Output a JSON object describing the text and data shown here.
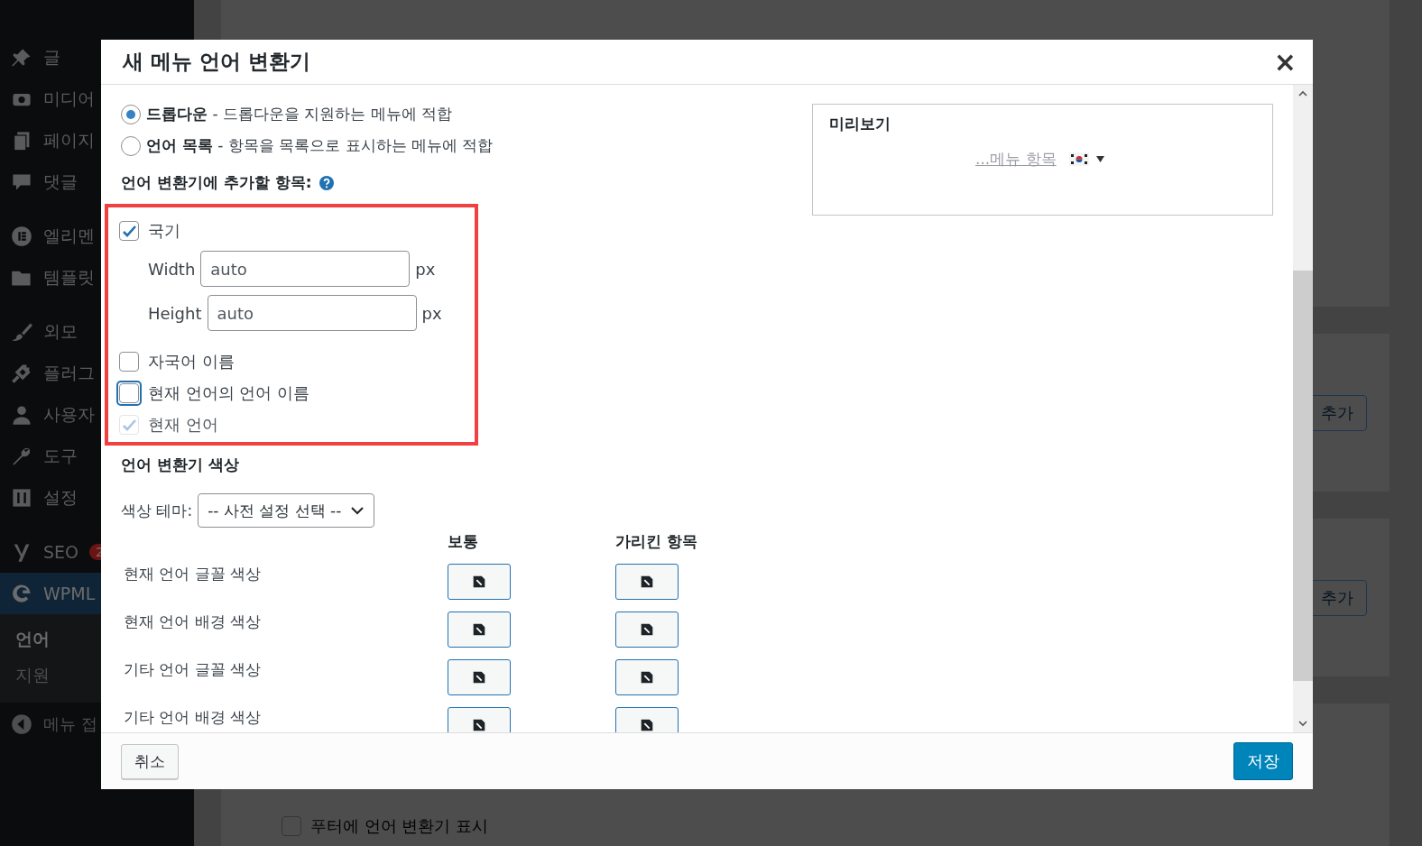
{
  "sidebar": {
    "groups": [
      [
        {
          "label": "글",
          "selected": false
        },
        {
          "label": "미디어",
          "selected": false
        },
        {
          "label": "페이지",
          "selected": false
        },
        {
          "label": "댓글",
          "selected": false
        }
      ],
      [
        {
          "label": "엘리멘",
          "selected": false
        },
        {
          "label": "템플릿",
          "selected": false
        }
      ],
      [
        {
          "label": "외모",
          "selected": false
        },
        {
          "label": "플러그",
          "selected": false
        },
        {
          "label": "사용자",
          "selected": false
        },
        {
          "label": "도구",
          "selected": false
        },
        {
          "label": "설정",
          "selected": false
        }
      ],
      [
        {
          "label": "SEO",
          "badge": "2",
          "selected": false
        },
        {
          "label": "WPML",
          "selected": true
        }
      ]
    ],
    "submenu": [
      {
        "label": "언어",
        "selected": true
      },
      {
        "label": "지원",
        "selected": false
      }
    ],
    "collapse": "메뉴 접"
  },
  "background": {
    "add_buttons": [
      "추가",
      "추가"
    ],
    "footer_checkbox": {
      "label": "푸터에 언어 변환기 표시",
      "checked": false
    }
  },
  "dialog": {
    "title": "새 메뉴 언어 변환기",
    "close": "×",
    "styles": [
      {
        "name": "드롭다운",
        "description": " - 드롭다운을 지원하는 메뉴에 적합",
        "selected": true
      },
      {
        "name": "언어 목록",
        "description": " - 항목을 목록으로 표시하는 메뉴에 적합",
        "selected": false
      }
    ],
    "items_heading": "언어 변환기에 추가할 항목:",
    "options": [
      {
        "kind": "checkbox",
        "label": "국기",
        "checked": true,
        "focused": false,
        "disabled": false
      },
      {
        "kind": "size",
        "label": "Width",
        "value": "auto",
        "unit": "px"
      },
      {
        "kind": "size",
        "label": "Height",
        "value": "auto",
        "unit": "px"
      },
      {
        "kind": "checkbox",
        "label": "자국어 이름",
        "checked": false,
        "focused": false,
        "disabled": false
      },
      {
        "kind": "checkbox",
        "label": "현재 언어의 언어 이름",
        "checked": false,
        "focused": true,
        "disabled": false
      },
      {
        "kind": "checkbox",
        "label": "현재 언어",
        "checked": true,
        "focused": false,
        "disabled": true
      }
    ],
    "colors_heading": "언어 변환기 색상",
    "theme_label": "색상 테마:",
    "theme_value": "-- 사전 설정 선택 --",
    "columns": [
      "보통",
      "가리킨 항목"
    ],
    "color_rows": [
      "현재 언어 글꼴 색상",
      "현재 언어 배경 색상",
      "기타 언어 글꼴 색상",
      "기타 언어 배경 색상"
    ],
    "preview": {
      "title": "미리보기",
      "link": "...메뉴 항목"
    },
    "cancel": "취소",
    "save": "저장"
  }
}
